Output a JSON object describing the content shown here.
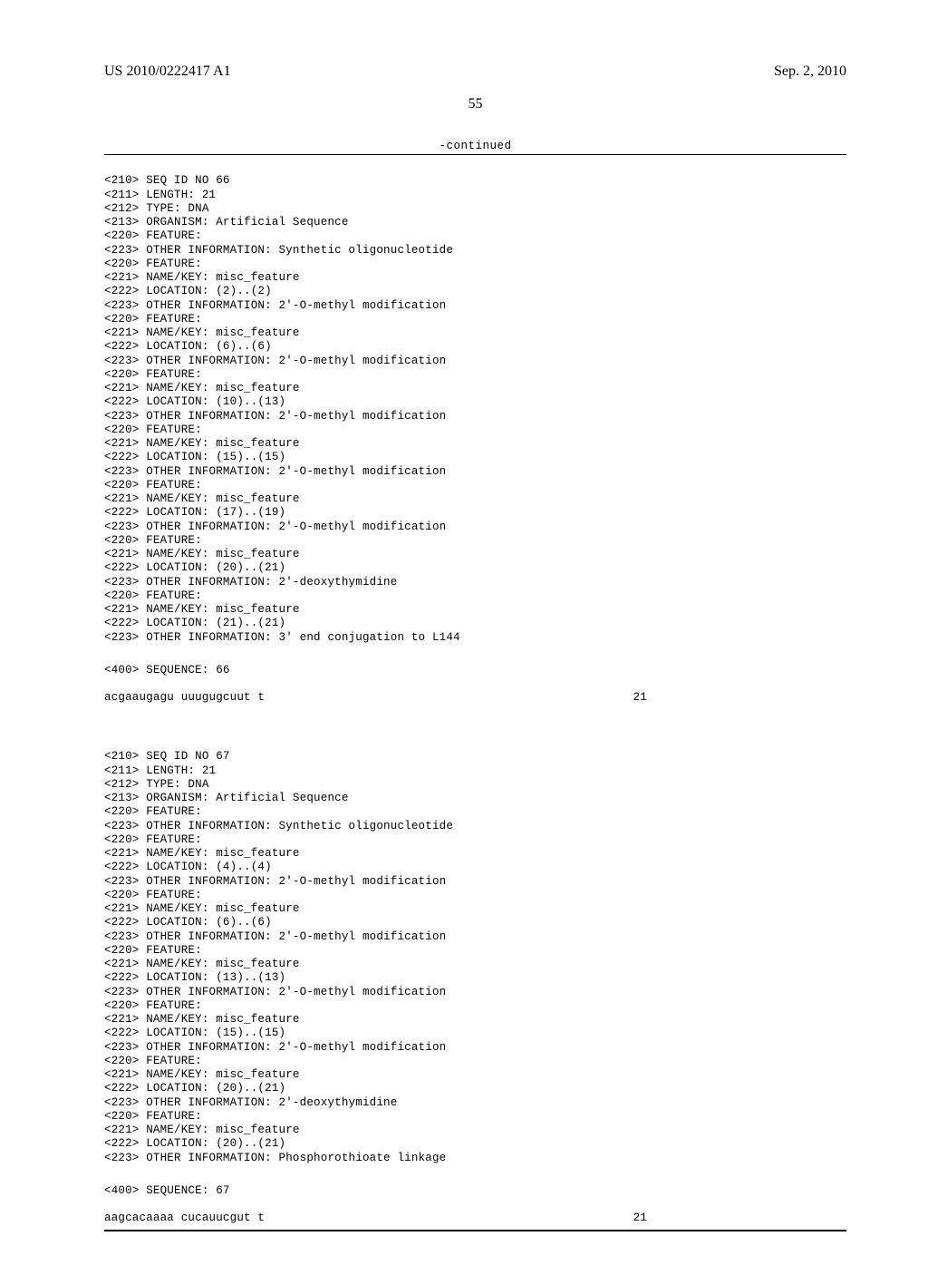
{
  "header": {
    "pubnum": "US 2010/0222417 A1",
    "date": "Sep. 2, 2010"
  },
  "pagenum": "55",
  "continued_label": "-continued",
  "seq66": {
    "l1": "<210> SEQ ID NO 66",
    "l2": "<211> LENGTH: 21",
    "l3": "<212> TYPE: DNA",
    "l4": "<213> ORGANISM: Artificial Sequence",
    "l5": "<220> FEATURE:",
    "l6": "<223> OTHER INFORMATION: Synthetic oligonucleotide",
    "l7": "<220> FEATURE:",
    "l8": "<221> NAME/KEY: misc_feature",
    "l9": "<222> LOCATION: (2)..(2)",
    "l10": "<223> OTHER INFORMATION: 2'-O-methyl modification",
    "l11": "<220> FEATURE:",
    "l12": "<221> NAME/KEY: misc_feature",
    "l13": "<222> LOCATION: (6)..(6)",
    "l14": "<223> OTHER INFORMATION: 2'-O-methyl modification",
    "l15": "<220> FEATURE:",
    "l16": "<221> NAME/KEY: misc_feature",
    "l17": "<222> LOCATION: (10)..(13)",
    "l18": "<223> OTHER INFORMATION: 2'-O-methyl modification",
    "l19": "<220> FEATURE:",
    "l20": "<221> NAME/KEY: misc_feature",
    "l21": "<222> LOCATION: (15)..(15)",
    "l22": "<223> OTHER INFORMATION: 2'-O-methyl modification",
    "l23": "<220> FEATURE:",
    "l24": "<221> NAME/KEY: misc_feature",
    "l25": "<222> LOCATION: (17)..(19)",
    "l26": "<223> OTHER INFORMATION: 2'-O-methyl modification",
    "l27": "<220> FEATURE:",
    "l28": "<221> NAME/KEY: misc_feature",
    "l29": "<222> LOCATION: (20)..(21)",
    "l30": "<223> OTHER INFORMATION: 2'-deoxythymidine",
    "l31": "<220> FEATURE:",
    "l32": "<221> NAME/KEY: misc_feature",
    "l33": "<222> LOCATION: (21)..(21)",
    "l34": "<223> OTHER INFORMATION: 3' end conjugation to L144",
    "l35": "<400> SEQUENCE: 66",
    "seq": "acgaaugagu uuugugcuut t",
    "len": "21"
  },
  "seq67": {
    "l1": "<210> SEQ ID NO 67",
    "l2": "<211> LENGTH: 21",
    "l3": "<212> TYPE: DNA",
    "l4": "<213> ORGANISM: Artificial Sequence",
    "l5": "<220> FEATURE:",
    "l6": "<223> OTHER INFORMATION: Synthetic oligonucleotide",
    "l7": "<220> FEATURE:",
    "l8": "<221> NAME/KEY: misc_feature",
    "l9": "<222> LOCATION: (4)..(4)",
    "l10": "<223> OTHER INFORMATION: 2'-O-methyl modification",
    "l11": "<220> FEATURE:",
    "l12": "<221> NAME/KEY: misc_feature",
    "l13": "<222> LOCATION: (6)..(6)",
    "l14": "<223> OTHER INFORMATION: 2'-O-methyl modification",
    "l15": "<220> FEATURE:",
    "l16": "<221> NAME/KEY: misc_feature",
    "l17": "<222> LOCATION: (13)..(13)",
    "l18": "<223> OTHER INFORMATION: 2'-O-methyl modification",
    "l19": "<220> FEATURE:",
    "l20": "<221> NAME/KEY: misc_feature",
    "l21": "<222> LOCATION: (15)..(15)",
    "l22": "<223> OTHER INFORMATION: 2'-O-methyl modification",
    "l23": "<220> FEATURE:",
    "l24": "<221> NAME/KEY: misc_feature",
    "l25": "<222> LOCATION: (20)..(21)",
    "l26": "<223> OTHER INFORMATION: 2'-deoxythymidine",
    "l27": "<220> FEATURE:",
    "l28": "<221> NAME/KEY: misc_feature",
    "l29": "<222> LOCATION: (20)..(21)",
    "l30": "<223> OTHER INFORMATION: Phosphorothioate linkage",
    "l31": "<400> SEQUENCE: 67",
    "seq": "aagcacaaaa cucauucgut t",
    "len": "21"
  }
}
